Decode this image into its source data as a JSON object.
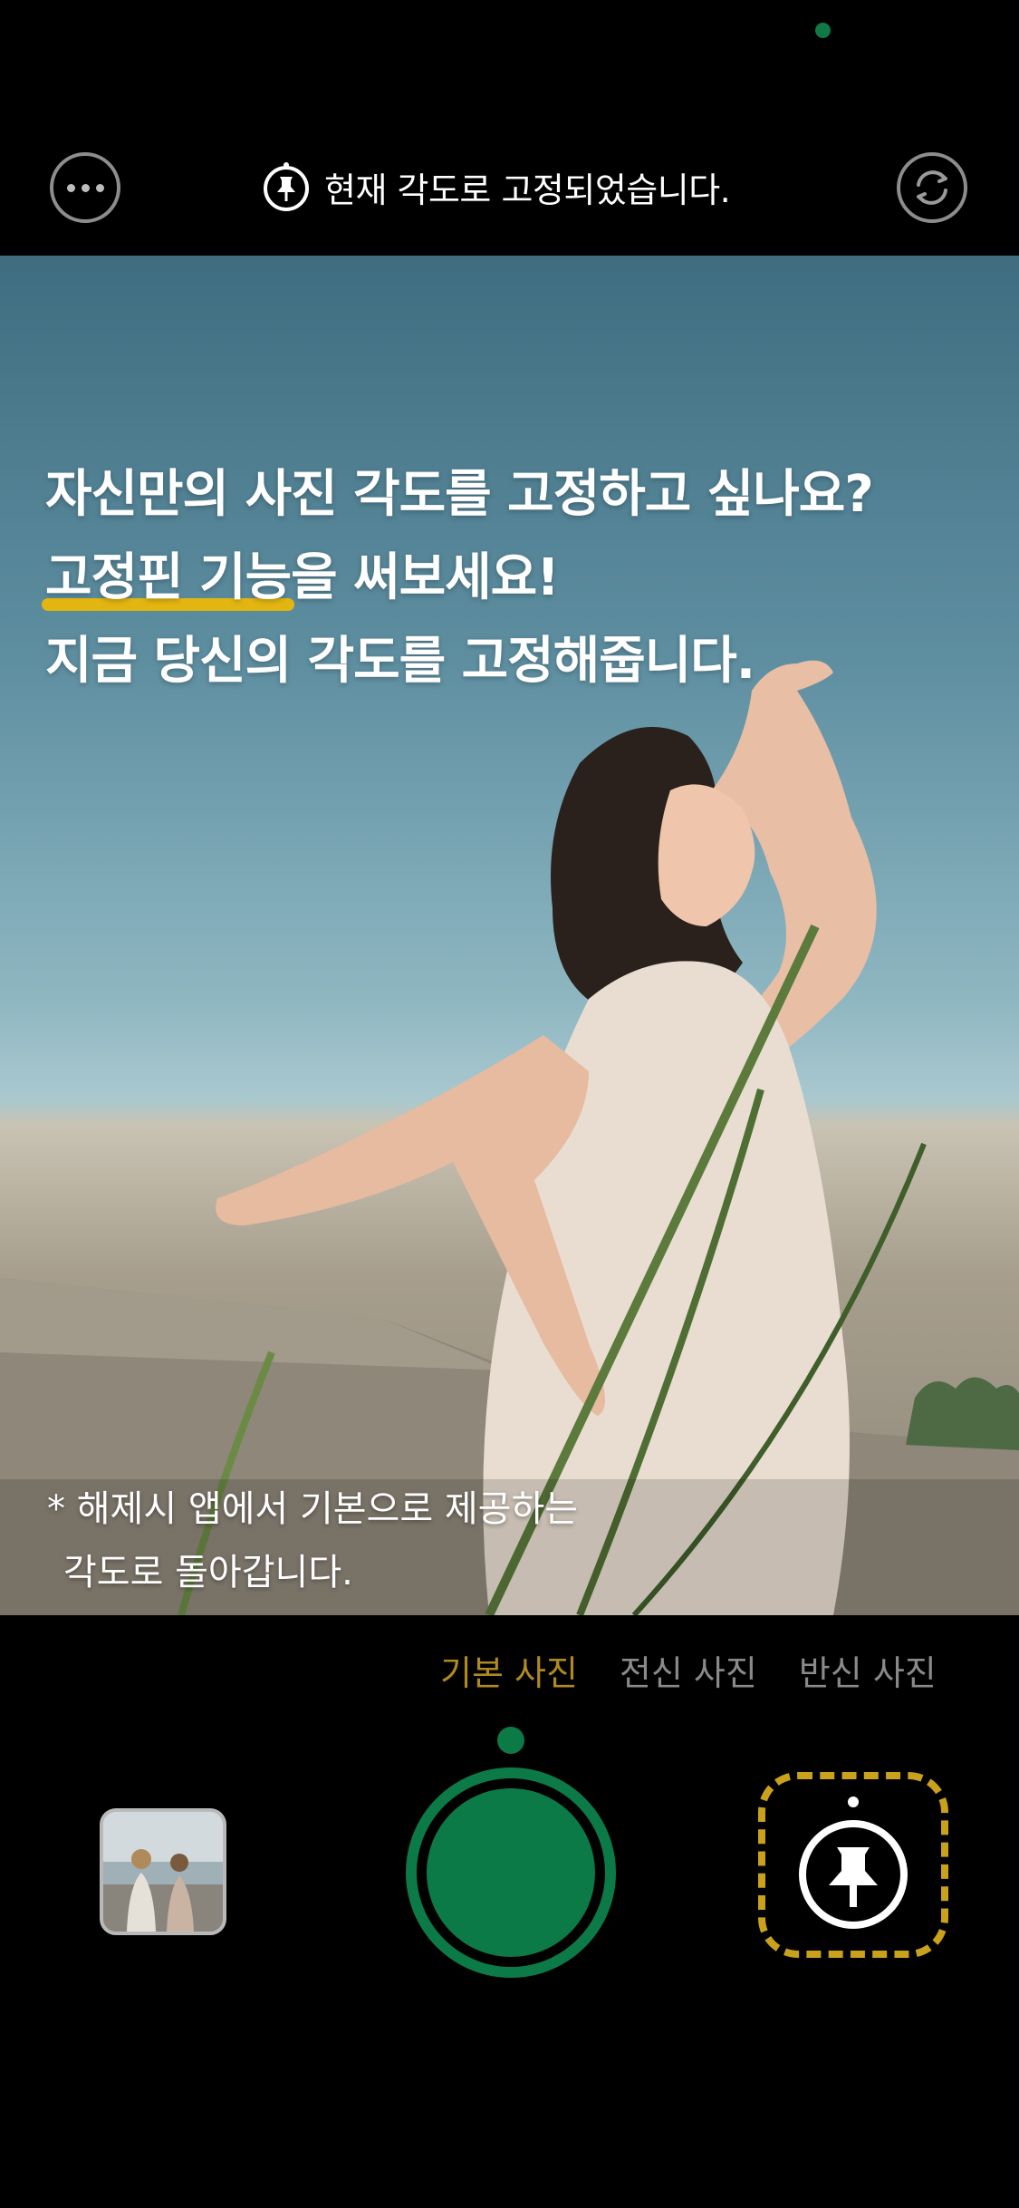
{
  "colors": {
    "accent_green": "#0c7a47",
    "highlight_yellow": "#e2b511",
    "active_tab": "#b08a1e",
    "inactive_tab": "#8a8a8a"
  },
  "top_bar": {
    "notice_text": "현재 각도로 고정되었습니다.",
    "more_icon": "more-horizontal-icon",
    "switch_icon": "camera-switch-icon",
    "notice_icon": "pin-icon"
  },
  "photo": {
    "headline": {
      "line1": "자신만의 사진 각도를 고정하고 싶나요?",
      "line2_highlight": "고정핀 기능",
      "line2_rest": "을 써보세요!",
      "line3": "지금 당신의 각도를 고정해줍니다."
    },
    "footnote": {
      "line1": "* 해제시 앱에서 기본으로 제공하는",
      "line2": "각도로 돌아갑니다."
    }
  },
  "mode_tabs": [
    {
      "label": "기본 사진",
      "active": true
    },
    {
      "label": "전신 사진",
      "active": false
    },
    {
      "label": "반신 사진",
      "active": false
    }
  ],
  "controls": {
    "gallery_icon": "gallery-thumbnail",
    "shutter_icon": "shutter-button",
    "pin_icon": "pin-icon"
  }
}
